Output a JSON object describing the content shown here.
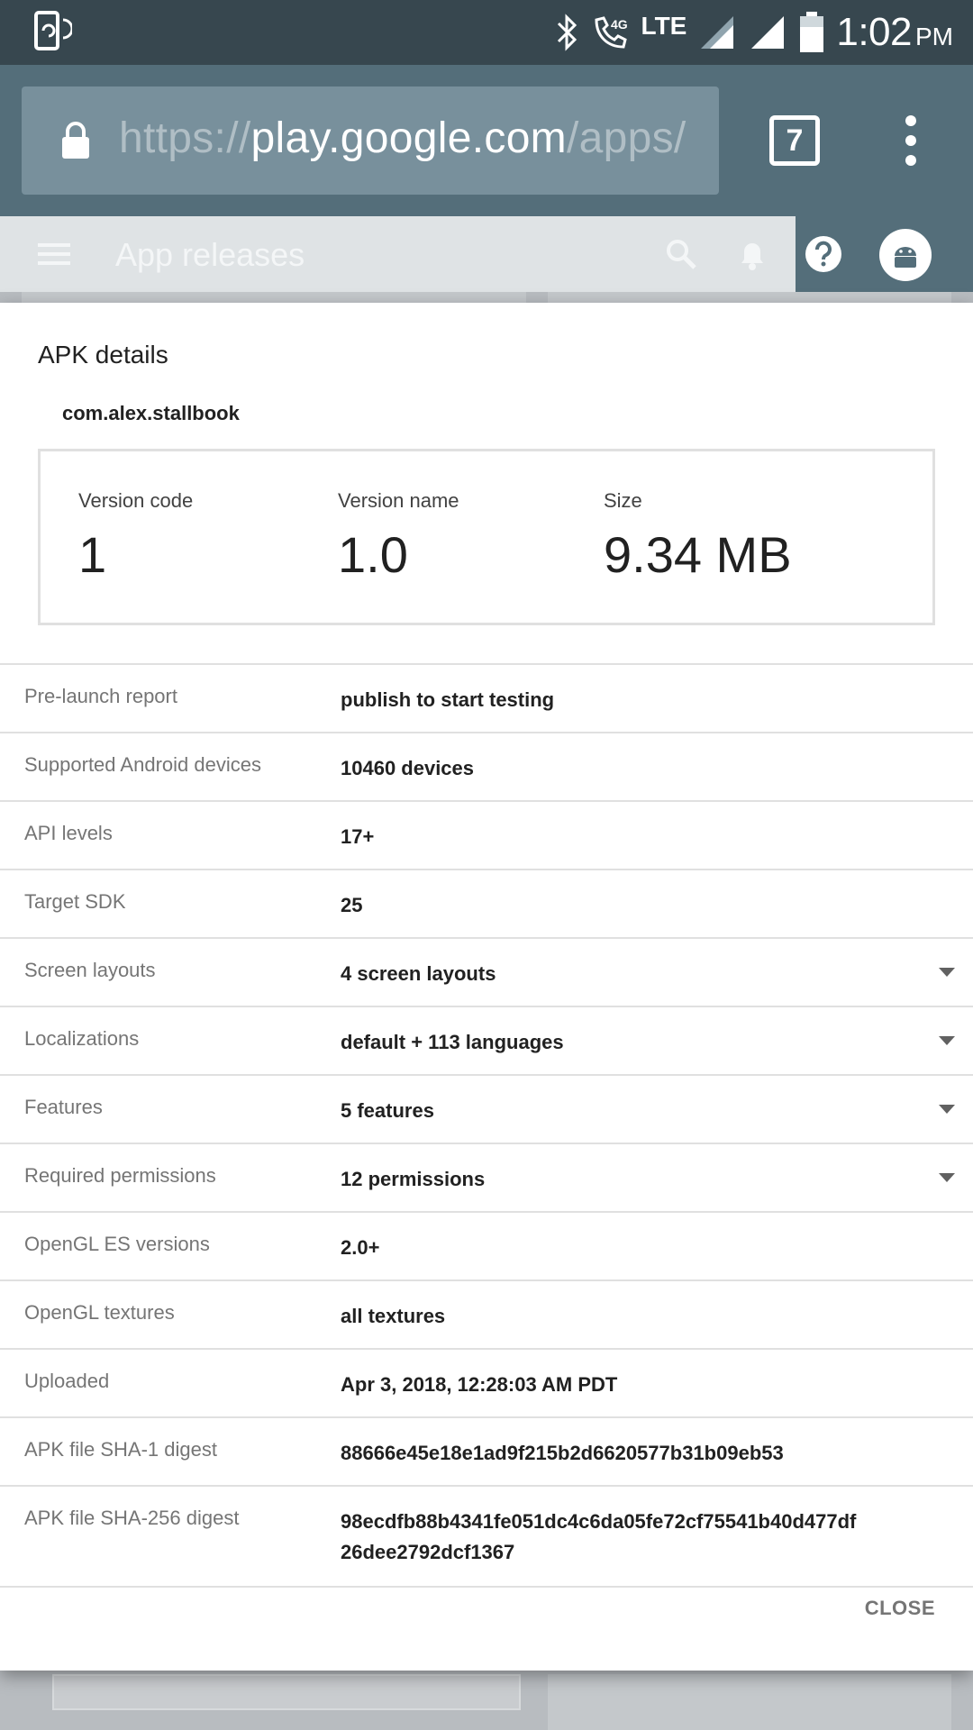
{
  "status_bar": {
    "network": "LTE",
    "time": "1:02",
    "ampm": "PM",
    "icons": [
      "sync-phone-icon",
      "bluetooth-icon",
      "volte-call-icon",
      "signal-icon",
      "signal-icon",
      "battery-icon"
    ]
  },
  "browser": {
    "url_scheme": "https://",
    "url_host": "play.google.com",
    "url_path": "/apps/",
    "tab_count": "7"
  },
  "app_bar": {
    "title": "App releases"
  },
  "dialog": {
    "title": "APK details",
    "package_name": "com.alex.stallbook",
    "summary": {
      "version_code_label": "Version code",
      "version_code": "1",
      "version_name_label": "Version name",
      "version_name": "1.0",
      "size_label": "Size",
      "size": "9.34 MB"
    },
    "rows": [
      {
        "key": "Pre-launch report",
        "value": "publish to start testing"
      },
      {
        "key": "Supported Android devices",
        "value": "10460 devices"
      },
      {
        "key": "API levels",
        "value": "17+"
      },
      {
        "key": "Target SDK",
        "value": "25"
      },
      {
        "key": "Screen layouts",
        "value": "4 screen layouts"
      },
      {
        "key": "Localizations",
        "value": "default + 113 languages"
      },
      {
        "key": "Features",
        "value": "5 features"
      },
      {
        "key": "Required permissions",
        "value": "12 permissions"
      },
      {
        "key": "OpenGL ES versions",
        "value": "2.0+"
      },
      {
        "key": "OpenGL textures",
        "value": "all textures"
      },
      {
        "key": "Uploaded",
        "value": "Apr 3, 2018, 12:28:03 AM PDT"
      },
      {
        "key": "APK file SHA-1 digest",
        "value": "88666e45e18e1ad9f215b2d6620577b31b09eb53"
      },
      {
        "key": "APK file SHA-256 digest",
        "value_line1": "98ecdfb88b4341fe051dc4c6da05fe72cf75541b40d477df",
        "value_line2": "26dee2792dcf1367"
      }
    ],
    "close_label": "CLOSE"
  }
}
